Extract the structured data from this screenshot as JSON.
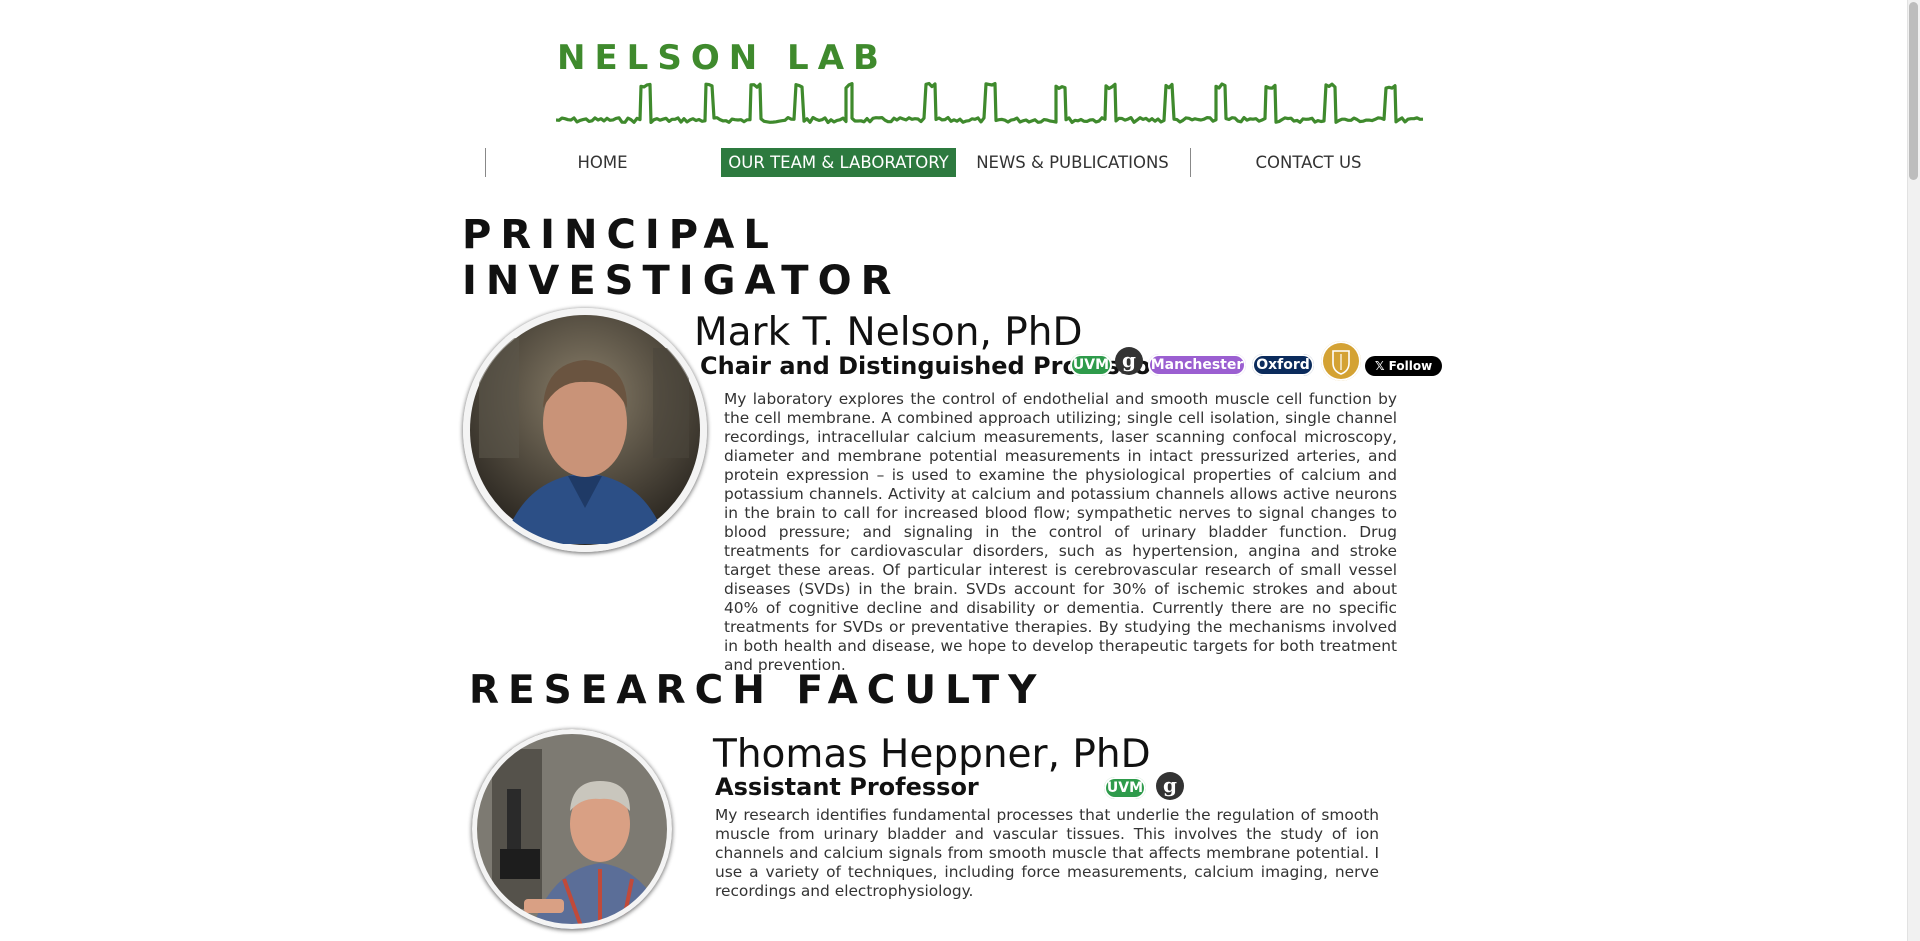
{
  "logo": {
    "text": "NELSON LAB"
  },
  "nav": {
    "items": [
      {
        "label": "HOME",
        "active": false
      },
      {
        "label": "OUR TEAM & LABORATORY",
        "active": true
      },
      {
        "label": "NEWS & PUBLICATIONS",
        "active": false
      },
      {
        "label": "CONTACT US",
        "active": false
      }
    ]
  },
  "pi": {
    "heading_line1": "PRINCIPAL",
    "heading_line2": "INVESTIGATOR",
    "name": "Mark T. Nelson, PhD",
    "title": "Chair and Distinguished Professor",
    "badges": {
      "uvm": "UVM",
      "scholar": "g",
      "manchester": "Manchester",
      "oxford": "Oxford",
      "twitter_follow": "Follow"
    },
    "bio": "My laboratory explores the control of endothelial and smooth muscle cell function by the cell membrane.  A combined approach utilizing; single cell isolation, single channel recordings, intracellular calcium measurements, laser scanning confocal microscopy, diameter and membrane potential measurements in intact pressurized arteries, and protein expression – is used to examine the physiological properties of calcium and potassium channels. Activity at calcium and potassium channels allows active neurons in the brain to call for increased blood flow; sympathetic nerves to signal changes to blood pressure; and signaling in the control of urinary bladder function.  Drug treatments for cardiovascular disorders, such as hypertension, angina and stroke target these areas.  Of particular interest is cerebrovascular research of small vessel diseases (SVDs) in the brain.  SVDs account for 30% of ischemic strokes and about 40% of cognitive decline and disability or dementia.  Currently there are no specific treatments for SVDs or preventative therapies.  By studying the mechanisms involved in both health and disease, we hope to develop therapeutic targets for both treatment and prevention."
  },
  "research_faculty": {
    "heading": "RESEARCH FACULTY",
    "members": [
      {
        "name": "Thomas Heppner, PhD",
        "title": "Assistant Professor",
        "badges": {
          "uvm": "UVM",
          "scholar": "g"
        },
        "bio": "My research identifies fundamental processes that underlie the regulation of smooth muscle from urinary bladder and vascular tissues.  This involves the study of ion channels and calcium signals from smooth muscle that affects membrane potential.  I use a variety of techniques, including force measurements, calcium imaging, nerve recordings and electrophysiology."
      }
    ]
  },
  "colors": {
    "brand_green": "#3f8a2d",
    "nav_active": "#2d7a3f",
    "uvm_badge": "#2e9b4b",
    "manchester_badge": "#9b5fd1",
    "oxford_badge": "#0b2b5c",
    "crest_badge": "#d4a233"
  },
  "icons": {
    "scholar": "google-scholar-icon",
    "crest": "university-crest-icon",
    "x": "x-logo-icon"
  }
}
